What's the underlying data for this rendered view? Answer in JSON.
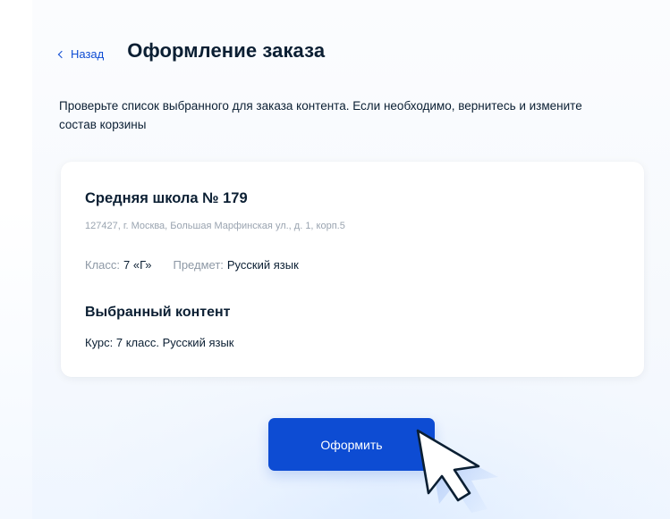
{
  "header": {
    "back_label": "Назад",
    "title": "Оформление заказа"
  },
  "description": "Проверьте список выбранного для заказа контента. Если необходимо, вернитесь и измените состав корзины",
  "order_card": {
    "school_name": "Средняя школа № 179",
    "address": "127427, г. Москва, Большая Марфинская ул., д. 1, корп.5",
    "class_label": "Класс:",
    "class_value": "7 «Г»",
    "subject_label": "Предмет:",
    "subject_value": "Русский язык",
    "selected_title": "Выбранный контент",
    "course": "Курс: 7 класс. Русский язык"
  },
  "actions": {
    "submit_label": "Оформить"
  },
  "icons": {
    "back": "chevron-left-icon",
    "pointer": "mouse-pointer-icon"
  },
  "colors": {
    "accent": "#0d4cd3",
    "text": "#0b1f33",
    "muted": "#8d98a5"
  }
}
